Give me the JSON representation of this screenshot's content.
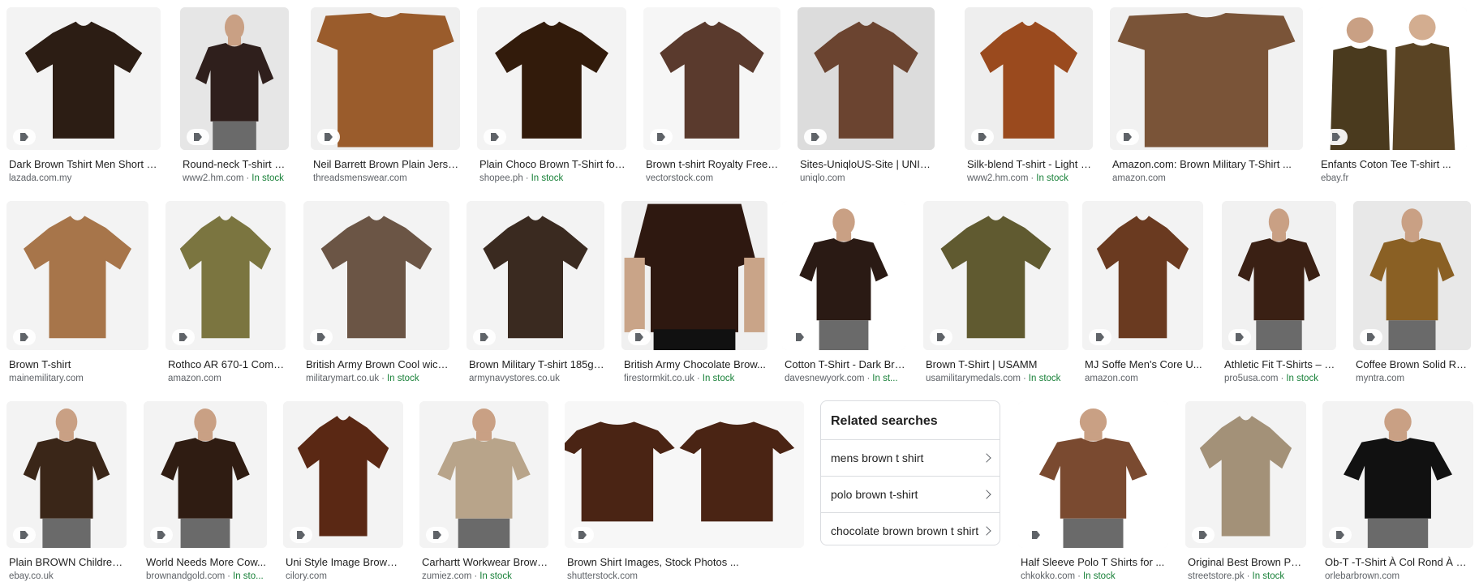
{
  "colors": {
    "in_stock": "#188038",
    "meta": "#5f6368",
    "title": "#1f1f1f"
  },
  "rows": [
    {
      "items": [
        {
          "title": "Dark Brown Tshirt Men Short Sl...",
          "source": "lazada.com.my",
          "stock": "",
          "shirt": "#2c1d14",
          "bg": "#f3f3f3",
          "kind": "tee"
        },
        {
          "title": "Round-neck T-shirt Reg...",
          "source": "www2.hm.com",
          "stock": "In stock",
          "shirt": "#2f1f1c",
          "bg": "#e6e6e6",
          "kind": "man"
        },
        {
          "title": "Neil Barrett Brown Plain Jerse...",
          "source": "threadsmenswear.com",
          "stock": "",
          "shirt": "#9a5c2c",
          "bg": "#efefef",
          "kind": "flat"
        },
        {
          "title": "Plain Choco Brown T-Shirt for ...",
          "source": "shopee.ph",
          "stock": "In stock",
          "shirt": "#321b0b",
          "bg": "#f3f3f3",
          "kind": "tee"
        },
        {
          "title": "Brown t-shirt Royalty Free V...",
          "source": "vectorstock.com",
          "stock": "",
          "shirt": "#5a3a2d",
          "bg": "#f6f6f6",
          "kind": "tee"
        },
        {
          "title": "Sites-UniqloUS-Site | UNIQLO ...",
          "source": "uniqlo.com",
          "stock": "",
          "shirt": "#6b4430",
          "bg": "#dcdcdc",
          "kind": "tee"
        },
        {
          "title": "Silk-blend T-shirt - Light b...",
          "source": "www2.hm.com",
          "stock": "In stock",
          "shirt": "#9a4a1e",
          "bg": "#eeeeee",
          "kind": "tee"
        },
        {
          "title": "Amazon.com: Brown Military T-Shirt ...",
          "source": "amazon.com",
          "stock": "",
          "shirt": "#7a5438",
          "bg": "#f1f1f1",
          "kind": "flat"
        },
        {
          "title": "Enfants Coton Tee T-shirt ...",
          "source": "ebay.fr",
          "stock": "",
          "shirt": "#4a3a1e",
          "bg": "#ffffff",
          "kind": "kids"
        }
      ]
    },
    {
      "items": [
        {
          "title": "Brown T-shirt",
          "source": "mainemilitary.com",
          "stock": "",
          "shirt": "#a7754a",
          "bg": "#f3f3f3",
          "kind": "tee"
        },
        {
          "title": "Rothco AR 670-1 Compl...",
          "source": "amazon.com",
          "stock": "",
          "shirt": "#7b7540",
          "bg": "#f3f3f3",
          "kind": "tee"
        },
        {
          "title": "British Army Brown Cool wick...",
          "source": "militarymart.co.uk",
          "stock": "In stock",
          "shirt": "#6b5545",
          "bg": "#f3f3f3",
          "kind": "tee"
        },
        {
          "title": "Brown Military T-shirt 185gs...",
          "source": "armynavystores.co.uk",
          "stock": "",
          "shirt": "#3a2a20",
          "bg": "#f3f3f3",
          "kind": "tee"
        },
        {
          "title": "British Army Chocolate Brow...",
          "source": "firestormkit.co.uk",
          "stock": "In stock",
          "shirt": "#2e1810",
          "bg": "#f0f0f0",
          "kind": "torso"
        },
        {
          "title": "Cotton T-Shirt - Dark Bro...",
          "source": "davesnewyork.com",
          "stock": "In st...",
          "shirt": "#2a1a14",
          "bg": "#ffffff",
          "kind": "man"
        },
        {
          "title": "Brown T-Shirt | USAMM",
          "source": "usamilitarymedals.com",
          "stock": "In stock",
          "shirt": "#605a30",
          "bg": "#f3f3f3",
          "kind": "tee"
        },
        {
          "title": "MJ Soffe Men's Core U...",
          "source": "amazon.com",
          "stock": "",
          "shirt": "#6a3a20",
          "bg": "#f3f3f3",
          "kind": "tee"
        },
        {
          "title": "Athletic Fit T-Shirts – P...",
          "source": "pro5usa.com",
          "stock": "In stock",
          "shirt": "#3a2014",
          "bg": "#f1f1f1",
          "kind": "man"
        },
        {
          "title": "Coffee Brown Solid Ro...",
          "source": "myntra.com",
          "stock": "",
          "shirt": "#8a6024",
          "bg": "#e8e8e8",
          "kind": "man"
        }
      ]
    },
    {
      "items": [
        {
          "title": "Plain BROWN Childrens ...",
          "source": "ebay.co.uk",
          "stock": "",
          "shirt": "#3a2618",
          "bg": "#f3f3f3",
          "kind": "man"
        },
        {
          "title": "World Needs More Cow...",
          "source": "brownandgold.com",
          "stock": "In sto...",
          "shirt": "#2f1c12",
          "bg": "#f3f3f3",
          "kind": "man"
        },
        {
          "title": "Uni Style Image Brown ...",
          "source": "cilory.com",
          "stock": "",
          "shirt": "#5a2814",
          "bg": "#f3f3f3",
          "kind": "tee"
        },
        {
          "title": "Carhartt Workwear Brown...",
          "source": "zumiez.com",
          "stock": "In stock",
          "shirt": "#b8a48a",
          "bg": "#f3f3f3",
          "kind": "man"
        },
        {
          "title": "Brown Shirt Images, Stock Photos ...",
          "source": "shutterstock.com",
          "stock": "",
          "shirt": "#4a2414",
          "bg": "#f7f7f7",
          "kind": "double"
        },
        {
          "title": "Half Sleeve Polo T Shirts for ...",
          "source": "chkokko.com",
          "stock": "In stock",
          "shirt": "#7a4a30",
          "bg": "#ffffff",
          "kind": "man"
        },
        {
          "title": "Original Best Brown Pol...",
          "source": "streetstore.pk",
          "stock": "In stock",
          "shirt": "#a39178",
          "bg": "#f3f3f3",
          "kind": "tee"
        },
        {
          "title": "Ob-T -T-Shirt À Col Rond À Co...",
          "source": "orlebarbrown.com",
          "stock": "",
          "shirt": "#111111",
          "bg": "#f3f3f3",
          "kind": "man"
        }
      ]
    }
  ],
  "related": {
    "heading": "Related searches",
    "items": [
      "mens brown t shirt",
      "polo brown t-shirt",
      "chocolate brown brown t shirt"
    ]
  }
}
